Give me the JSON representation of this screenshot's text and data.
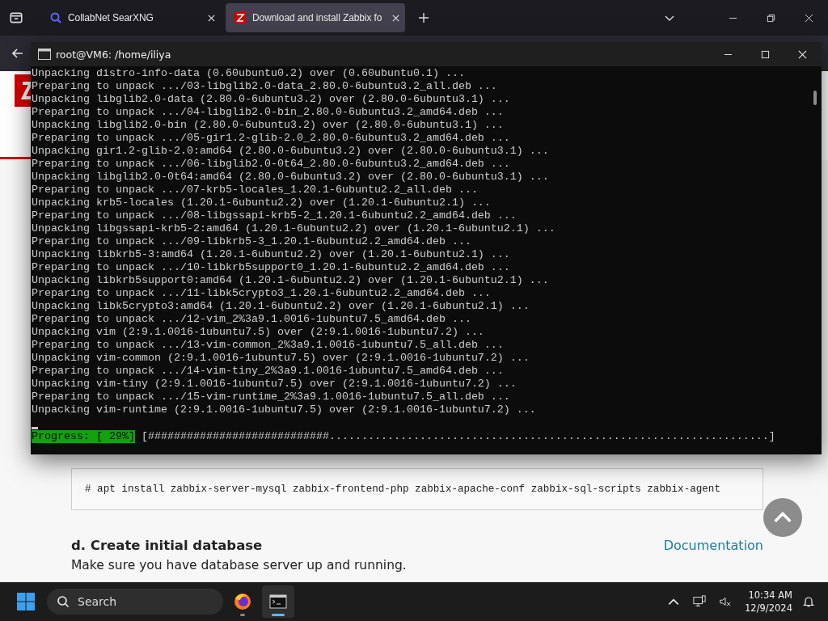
{
  "browser": {
    "tabs": [
      {
        "title": "CollabNet SearXNG",
        "selected": false
      },
      {
        "title": "Download and install Zabbix fo",
        "selected": true
      }
    ]
  },
  "terminal": {
    "title": "root@VM6: /home/iliya",
    "lines": [
      "Unpacking distro-info-data (0.60ubuntu0.2) over (0.60ubuntu0.1) ...",
      "Preparing to unpack .../03-libglib2.0-data_2.80.0-6ubuntu3.2_all.deb ...",
      "Unpacking libglib2.0-data (2.80.0-6ubuntu3.2) over (2.80.0-6ubuntu3.1) ...",
      "Preparing to unpack .../04-libglib2.0-bin_2.80.0-6ubuntu3.2_amd64.deb ...",
      "Unpacking libglib2.0-bin (2.80.0-6ubuntu3.2) over (2.80.0-6ubuntu3.1) ...",
      "Preparing to unpack .../05-gir1.2-glib-2.0_2.80.0-6ubuntu3.2_amd64.deb ...",
      "Unpacking gir1.2-glib-2.0:amd64 (2.80.0-6ubuntu3.2) over (2.80.0-6ubuntu3.1) ...",
      "Preparing to unpack .../06-libglib2.0-0t64_2.80.0-6ubuntu3.2_amd64.deb ...",
      "Unpacking libglib2.0-0t64:amd64 (2.80.0-6ubuntu3.2) over (2.80.0-6ubuntu3.1) ...",
      "Preparing to unpack .../07-krb5-locales_1.20.1-6ubuntu2.2_all.deb ...",
      "Unpacking krb5-locales (1.20.1-6ubuntu2.2) over (1.20.1-6ubuntu2.1) ...",
      "Preparing to unpack .../08-libgssapi-krb5-2_1.20.1-6ubuntu2.2_amd64.deb ...",
      "Unpacking libgssapi-krb5-2:amd64 (1.20.1-6ubuntu2.2) over (1.20.1-6ubuntu2.1) ...",
      "Preparing to unpack .../09-libkrb5-3_1.20.1-6ubuntu2.2_amd64.deb ...",
      "Unpacking libkrb5-3:amd64 (1.20.1-6ubuntu2.2) over (1.20.1-6ubuntu2.1) ...",
      "Preparing to unpack .../10-libkrb5support0_1.20.1-6ubuntu2.2_amd64.deb ...",
      "Unpacking libkrb5support0:amd64 (1.20.1-6ubuntu2.2) over (1.20.1-6ubuntu2.1) ...",
      "Preparing to unpack .../11-libk5crypto3_1.20.1-6ubuntu2.2_amd64.deb ...",
      "Unpacking libk5crypto3:amd64 (1.20.1-6ubuntu2.2) over (1.20.1-6ubuntu2.1) ...",
      "Preparing to unpack .../12-vim_2%3a9.1.0016-1ubuntu7.5_amd64.deb ...",
      "Unpacking vim (2:9.1.0016-1ubuntu7.5) over (2:9.1.0016-1ubuntu7.2) ...",
      "Preparing to unpack .../13-vim-common_2%3a9.1.0016-1ubuntu7.5_all.deb ...",
      "Unpacking vim-common (2:9.1.0016-1ubuntu7.5) over (2:9.1.0016-1ubuntu7.2) ...",
      "Preparing to unpack .../14-vim-tiny_2%3a9.1.0016-1ubuntu7.5_amd64.deb ...",
      "Unpacking vim-tiny (2:9.1.0016-1ubuntu7.5) over (2:9.1.0016-1ubuntu7.2) ...",
      "Preparing to unpack .../15-vim-runtime_2%3a9.1.0016-1ubuntu7.5_all.deb ...",
      "Unpacking vim-runtime (2:9.1.0016-1ubuntu7.5) over (2:9.1.0016-1ubuntu7.2) ..."
    ],
    "progress_label": "Progress: [ 29%]",
    "progress_bar": "[############################....................................................................]"
  },
  "page": {
    "command": "# apt install zabbix-server-mysql zabbix-frontend-php zabbix-apache-conf zabbix-sql-scripts zabbix-agent",
    "heading": "d. Create initial database",
    "link": "Documentation",
    "text": "Make sure you have database server up and running."
  },
  "taskbar": {
    "search_placeholder": "Search",
    "apps": [
      {
        "kind": "firefox",
        "selected": false
      },
      {
        "kind": "terminal",
        "selected": true
      }
    ],
    "time": "10:34 AM",
    "date": "12/9/2024"
  }
}
